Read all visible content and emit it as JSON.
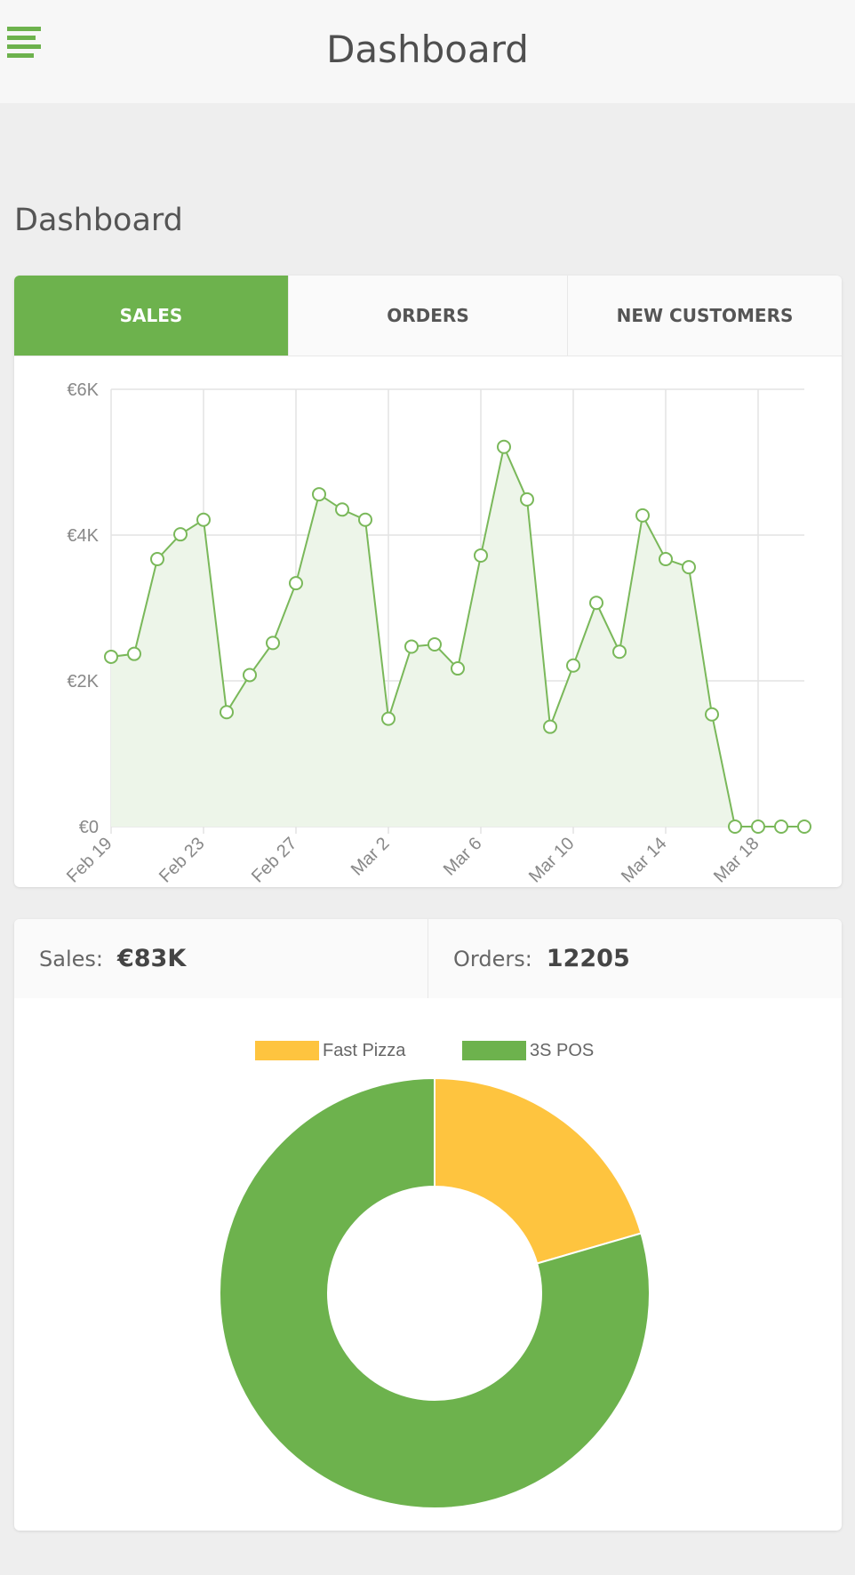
{
  "header": {
    "title": "Dashboard",
    "menu_icon": "hamburger-menu-icon"
  },
  "page": {
    "title": "Dashboard"
  },
  "tabs": [
    {
      "label": "SALES",
      "active": true
    },
    {
      "label": "ORDERS",
      "active": false
    },
    {
      "label": "NEW CUSTOMERS",
      "active": false
    }
  ],
  "summary": {
    "sales_label": "Sales:",
    "sales_value": "€83K",
    "orders_label": "Orders:",
    "orders_value": "12205"
  },
  "colors": {
    "accent": "#6db24d",
    "line": "#7ab85a",
    "fill": "#edf5e9",
    "grid": "#e3e3e3",
    "axis_text": "#888888",
    "fast_pizza": "#fec43f",
    "pos": "#6db24d"
  },
  "chart_data": [
    {
      "type": "line",
      "series_fill": true,
      "x": [
        "Feb 19",
        "Feb 20",
        "Feb 21",
        "Feb 22",
        "Feb 23",
        "Feb 24",
        "Feb 25",
        "Feb 26",
        "Feb 27",
        "Feb 28",
        "Mar 1",
        "Mar 2",
        "Mar 3",
        "Mar 4",
        "Mar 5",
        "Mar 6",
        "Mar 7",
        "Mar 8",
        "Mar 9",
        "Mar 10",
        "Mar 11",
        "Mar 12",
        "Mar 13",
        "Mar 14",
        "Mar 15",
        "Mar 16",
        "Mar 17",
        "Mar 18",
        "Mar 19",
        "Mar 20",
        "Mar 21"
      ],
      "values": [
        2330,
        2370,
        3670,
        4010,
        4210,
        1570,
        2080,
        2520,
        3340,
        4560,
        4350,
        4210,
        1480,
        2470,
        2500,
        2170,
        3720,
        5210,
        4490,
        1370,
        2210,
        3070,
        2400,
        4270,
        3670,
        3560,
        1540,
        0,
        0,
        0,
        0
      ],
      "x_tick_labels": [
        "Feb 19",
        "Feb 23",
        "Feb 27",
        "Mar 2",
        "Mar 6",
        "Mar 10",
        "Mar 14",
        "Mar 18"
      ],
      "x_tick_index": [
        0,
        4,
        8,
        12,
        16,
        20,
        24,
        28
      ],
      "y_ticks": [
        0,
        2000,
        4000,
        6000
      ],
      "y_tick_labels": [
        "€0",
        "€2K",
        "€4K",
        "€6K"
      ],
      "ylim": [
        0,
        6000
      ],
      "grid": true
    },
    {
      "type": "pie",
      "donut": true,
      "legend_position": "top",
      "labels": [
        "Fast Pizza",
        "3S POS"
      ],
      "values": [
        20.5,
        79.5
      ]
    }
  ]
}
